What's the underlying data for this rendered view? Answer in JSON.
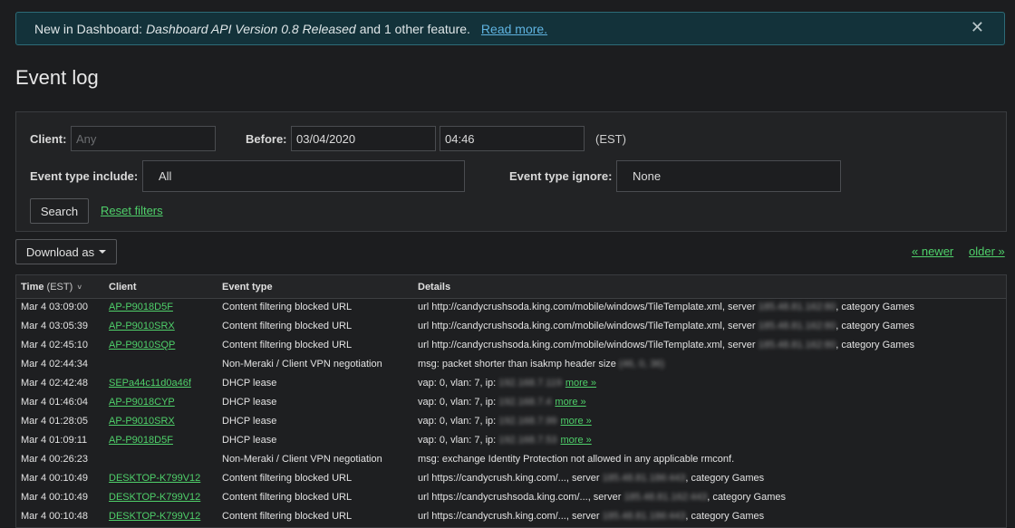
{
  "banner": {
    "prefix": "New in Dashboard:",
    "feature": "Dashboard API Version 0.8 Released",
    "suffix": "and 1 other feature.",
    "link": "Read more.",
    "close": "✕"
  },
  "title": "Event log",
  "filters": {
    "client_label": "Client:",
    "client_placeholder": "Any",
    "before_label": "Before:",
    "before_date": "03/04/2020",
    "before_time": "04:46",
    "tz": "(EST)",
    "include_label": "Event type include:",
    "include_value": "All",
    "ignore_label": "Event type ignore:",
    "ignore_value": "None",
    "search_button": "Search",
    "reset_link": "Reset filters"
  },
  "download_label": "Download as",
  "pager": {
    "newer": "« newer",
    "older": "older »"
  },
  "columns": {
    "time": "Time",
    "time_tz": "(EST)",
    "client": "Client",
    "event_type": "Event type",
    "details": "Details"
  },
  "rows": [
    {
      "time": "Mar 4 03:09:00",
      "client": "AP-P9018D5F",
      "type": "Content filtering blocked URL",
      "pre": "url http://candycrushsoda.king.com/mobile/windows/TileTemplate.xml, server",
      "blur": "185.48.81.162:80",
      "post": ", category Games",
      "more": ""
    },
    {
      "time": "Mar 4 03:05:39",
      "client": "AP-P9010SRX",
      "type": "Content filtering blocked URL",
      "pre": "url http://candycrushsoda.king.com/mobile/windows/TileTemplate.xml, server",
      "blur": "185.48.81.162:80",
      "post": ", category Games",
      "more": ""
    },
    {
      "time": "Mar 4 02:45:10",
      "client": "AP-P9010SQP",
      "type": "Content filtering blocked URL",
      "pre": "url http://candycrushsoda.king.com/mobile/windows/TileTemplate.xml, server",
      "blur": "185.48.81.162:80",
      "post": ", category Games",
      "more": ""
    },
    {
      "time": "Mar 4 02:44:34",
      "client": "",
      "type": "Non-Meraki / Client VPN negotiation",
      "pre": "msg: packet shorter than isakmp header size",
      "blur": "(46, 0, 36)",
      "post": "",
      "more": ""
    },
    {
      "time": "Mar 4 02:42:48",
      "client": "SEPa44c11d0a46f",
      "type": "DHCP lease",
      "pre": "vap: 0, vlan: 7, ip:",
      "blur": "192.168.7.119",
      "post": "",
      "more": "more »"
    },
    {
      "time": "Mar 4 01:46:04",
      "client": "AP-P9018CYP",
      "type": "DHCP lease",
      "pre": "vap: 0, vlan: 7, ip:",
      "blur": "192.168.7.4",
      "post": "",
      "more": "more »"
    },
    {
      "time": "Mar 4 01:28:05",
      "client": "AP-P9010SRX",
      "type": "DHCP lease",
      "pre": "vap: 0, vlan: 7, ip:",
      "blur": "192.168.7.99",
      "post": "",
      "more": "more »"
    },
    {
      "time": "Mar 4 01:09:11",
      "client": "AP-P9018D5F",
      "type": "DHCP lease",
      "pre": "vap: 0, vlan: 7, ip:",
      "blur": "192.168.7.53",
      "post": "",
      "more": "more »"
    },
    {
      "time": "Mar 4 00:26:23",
      "client": "",
      "type": "Non-Meraki / Client VPN negotiation",
      "pre": "msg: exchange Identity Protection not allowed in any applicable rmconf.",
      "blur": "",
      "post": "",
      "more": ""
    },
    {
      "time": "Mar 4 00:10:49",
      "client": "DESKTOP-K799V12",
      "type": "Content filtering blocked URL",
      "pre": "url https://candycrush.king.com/..., server",
      "blur": "185.48.81.186:443",
      "post": ", category Games",
      "more": ""
    },
    {
      "time": "Mar 4 00:10:49",
      "client": "DESKTOP-K799V12",
      "type": "Content filtering blocked URL",
      "pre": "url https://candycrushsoda.king.com/..., server",
      "blur": "185.48.81.162:443",
      "post": ", category Games",
      "more": ""
    },
    {
      "time": "Mar 4 00:10:48",
      "client": "DESKTOP-K799V12",
      "type": "Content filtering blocked URL",
      "pre": "url https://candycrush.king.com/..., server",
      "blur": "185.48.81.186:443",
      "post": ", category Games",
      "more": ""
    }
  ]
}
